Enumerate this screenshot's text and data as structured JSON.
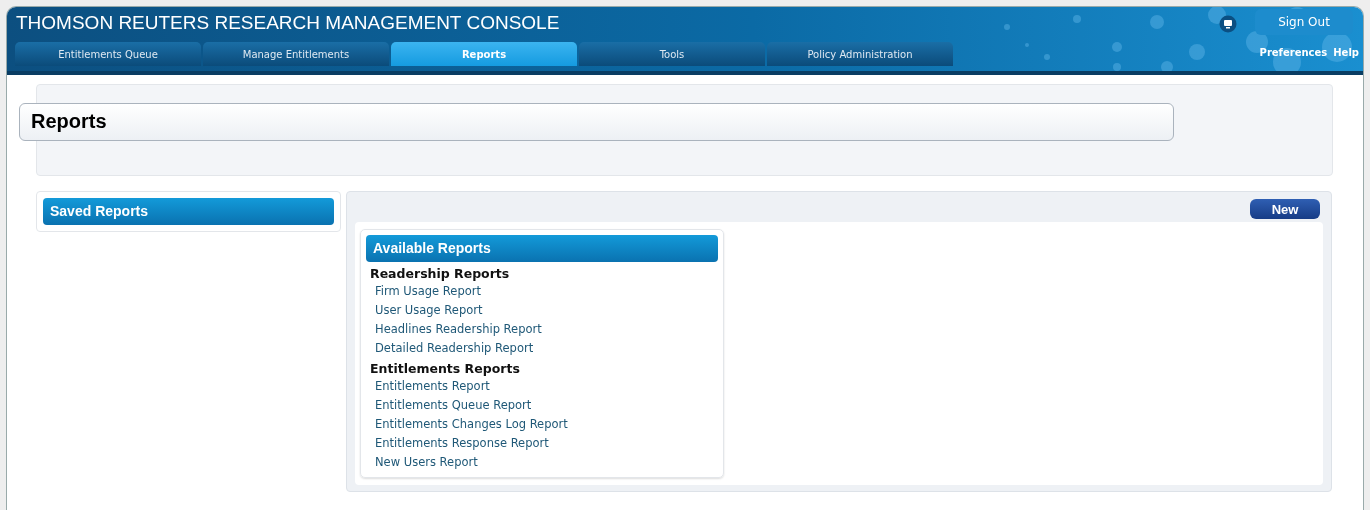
{
  "header": {
    "title": "THOMSON REUTERS RESEARCH MANAGEMENT CONSOLE",
    "sign_out": "Sign Out",
    "links": [
      "Preferences",
      "Help"
    ]
  },
  "tabs": [
    {
      "label": "Entitlements Queue",
      "selected": false
    },
    {
      "label": "Manage Entitlements",
      "selected": false
    },
    {
      "label": "Reports",
      "selected": true
    },
    {
      "label": "Tools",
      "selected": false
    },
    {
      "label": "Policy Administration",
      "selected": false
    }
  ],
  "page_title": "Reports",
  "saved_reports": {
    "title": "Saved Reports"
  },
  "new_button": "New",
  "available_reports": {
    "title": "Available Reports",
    "groups": [
      {
        "heading": "Readership Reports",
        "items": [
          "Firm Usage Report",
          "User Usage Report",
          "Headlines Readership Report",
          "Detailed Readership Report"
        ]
      },
      {
        "heading": "Entitlements Reports",
        "items": [
          "Entitlements Report",
          "Entitlements Queue Report",
          "Entitlements Changes Log Report",
          "Entitlements Response Report",
          "New Users Report"
        ]
      }
    ]
  }
}
